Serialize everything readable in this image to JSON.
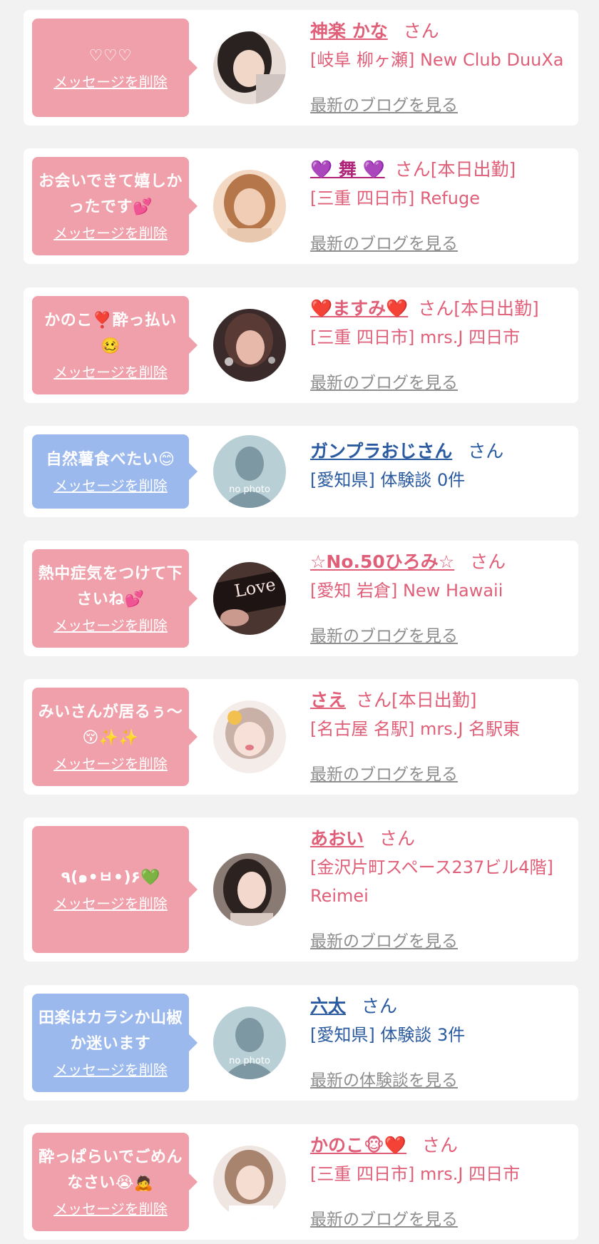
{
  "delete_label": "メッセージを削除",
  "honorific": "さん",
  "messages": [
    {
      "bubble_text": "♡♡♡",
      "bubble_color": "pink",
      "name": "神楽 かな",
      "suffix": "",
      "shop": "[岐阜 柳ヶ瀬] New Club DuuXa",
      "link": "最新のブログを見る",
      "avatar": "photo-woman-dark-hair"
    },
    {
      "bubble_text": "お会いできて嬉しかったです💕",
      "bubble_color": "pink",
      "name": "💜 舞 💜",
      "suffix": "[本日出勤]",
      "shop": "[三重 四日市] Refuge",
      "link": "最新のブログを見る",
      "avatar": "photo-woman-brown-hair"
    },
    {
      "bubble_text": "かのこ❣️酔っ払い🥴",
      "bubble_color": "pink",
      "name": "❤️ますみ❤️",
      "suffix": "[本日出勤]",
      "shop": "[三重 四日市] mrs.J 四日市",
      "link": "最新のブログを見る",
      "avatar": "photo-woman-night"
    },
    {
      "bubble_text": "自然薯食べたい😊",
      "bubble_color": "blue",
      "name": "ガンプラおじさん",
      "suffix": "",
      "shop": "[愛知県] 体験談 0件",
      "link": "",
      "avatar": "no-photo",
      "avatar_text": "no photo"
    },
    {
      "bubble_text": "熱中症気をつけて下さいね💕",
      "bubble_color": "pink",
      "name": "☆No.50ひろみ☆",
      "suffix": "",
      "shop": "[愛知 岩倉] New Hawaii",
      "link": "最新のブログを見る",
      "avatar": "photo-love-text"
    },
    {
      "bubble_text": "みいさんが居るぅ〜😚✨✨",
      "bubble_color": "pink",
      "name": "さえ",
      "suffix": "[本日出勤]",
      "shop": "[名古屋 名駅] mrs.J 名駅東",
      "link": "最新のブログを見る",
      "avatar": "photo-woman-filter"
    },
    {
      "bubble_text": "٩(๑•ㅂ•)۶💚",
      "bubble_color": "pink",
      "name": "あおい",
      "suffix": "",
      "shop": "[金沢片町スペース237ビル4階] Reimei",
      "link": "最新のブログを見る",
      "avatar": "photo-woman-long-hair"
    },
    {
      "bubble_text": "田楽はカラシか山椒か迷います",
      "bubble_color": "blue",
      "name": "六太",
      "suffix": "",
      "shop": "[愛知県] 体験談 3件",
      "link": "最新の体験談を見る",
      "avatar": "no-photo",
      "avatar_text": "no photo"
    },
    {
      "bubble_text": "酔っぱらいでごめんなさい😭🙇",
      "bubble_color": "pink",
      "name": "かのこ🐵❤️",
      "suffix": "",
      "shop": "[三重 四日市] mrs.J 四日市",
      "link": "最新のブログを見る",
      "avatar": "photo-woman-light-hair"
    }
  ]
}
